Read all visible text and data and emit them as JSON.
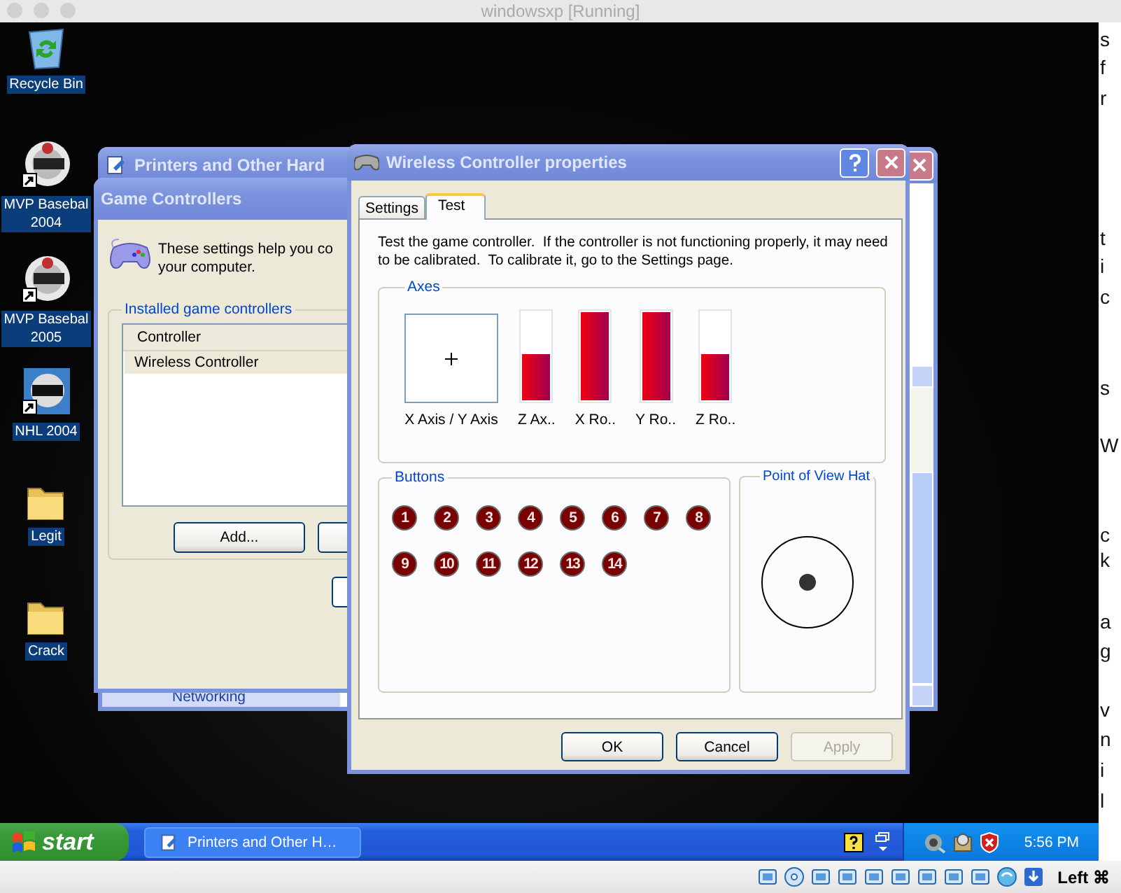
{
  "host_window": {
    "title": "windowsxp [Running]"
  },
  "desktop_icons": [
    {
      "kind": "recycle-bin",
      "label_lines": [
        "Recycle Bin"
      ]
    },
    {
      "kind": "game-disc",
      "label_lines": [
        "MVP Basebal",
        "2004"
      ]
    },
    {
      "kind": "game-disc",
      "label_lines": [
        "MVP Basebal",
        "2005"
      ]
    },
    {
      "kind": "game-tile",
      "label_lines": [
        "NHL 2004"
      ]
    },
    {
      "kind": "folder",
      "label_lines": [
        "Legit"
      ]
    },
    {
      "kind": "folder",
      "label_lines": [
        "Crack"
      ]
    }
  ],
  "printers_window": {
    "title": "Printers and Other Hard",
    "side_item": "Networking"
  },
  "game_controllers_window": {
    "title": "Game Controllers",
    "intro_lines": [
      "These settings help you co",
      "your computer."
    ],
    "group_label": "Installed game controllers",
    "list": {
      "column": "Controller",
      "rows": [
        {
          "name": "Wireless Controller",
          "selected": true
        }
      ]
    },
    "buttons": [
      "Add..."
    ]
  },
  "properties_window": {
    "title": "Wireless Controller properties",
    "tabs": [
      {
        "label": "Settings",
        "selected": false
      },
      {
        "label": "Test",
        "selected": true
      }
    ],
    "description": "Test the game controller.  If the controller is not functioning properly, it may need to be calibrated.  To calibrate it, go to the Settings page.",
    "axes_label": "Axes",
    "axes": [
      {
        "kind": "xy",
        "label": "X Axis / Y Axis"
      },
      {
        "kind": "bar",
        "label": "Z Ax..",
        "level": 0.52
      },
      {
        "kind": "bar",
        "label": "X Ro..",
        "level": 1
      },
      {
        "kind": "bar",
        "label": "Y Ro..",
        "level": 1
      },
      {
        "kind": "bar",
        "label": "Z Ro..",
        "level": 0.53
      }
    ],
    "buttons_label": "Buttons",
    "controller_buttons": [
      {
        "label": "1",
        "pressed": false
      },
      {
        "label": "2",
        "pressed": false
      },
      {
        "label": "3",
        "pressed": false
      },
      {
        "label": "4",
        "pressed": false
      },
      {
        "label": "5",
        "pressed": false
      },
      {
        "label": "6",
        "pressed": false
      },
      {
        "label": "7",
        "pressed": false
      },
      {
        "label": "8",
        "pressed": false
      },
      {
        "label": "9",
        "pressed": false
      },
      {
        "label": "10",
        "pressed": false
      },
      {
        "label": "11",
        "pressed": false
      },
      {
        "label": "12",
        "pressed": false
      },
      {
        "label": "13",
        "pressed": false
      },
      {
        "label": "14",
        "pressed": false
      }
    ],
    "pov_label": "Point of View Hat",
    "dialog_buttons": [
      {
        "label": "OK",
        "disabled": false
      },
      {
        "label": "Cancel",
        "disabled": false
      },
      {
        "label": "Apply",
        "disabled": true
      }
    ]
  },
  "taskbar": {
    "start_label": "start",
    "tasks": [
      {
        "label": "Printers and Other H…",
        "selected": false
      }
    ],
    "clock": "5:56 PM"
  },
  "vm_status": {
    "keyboard_indicator": "Left ⌘"
  },
  "edge_fragments": [
    "s",
    "f",
    "r",
    "t",
    "i",
    "c",
    "s",
    "W",
    "c",
    "k",
    "a",
    "g",
    "v",
    "n",
    "i",
    "l"
  ]
}
